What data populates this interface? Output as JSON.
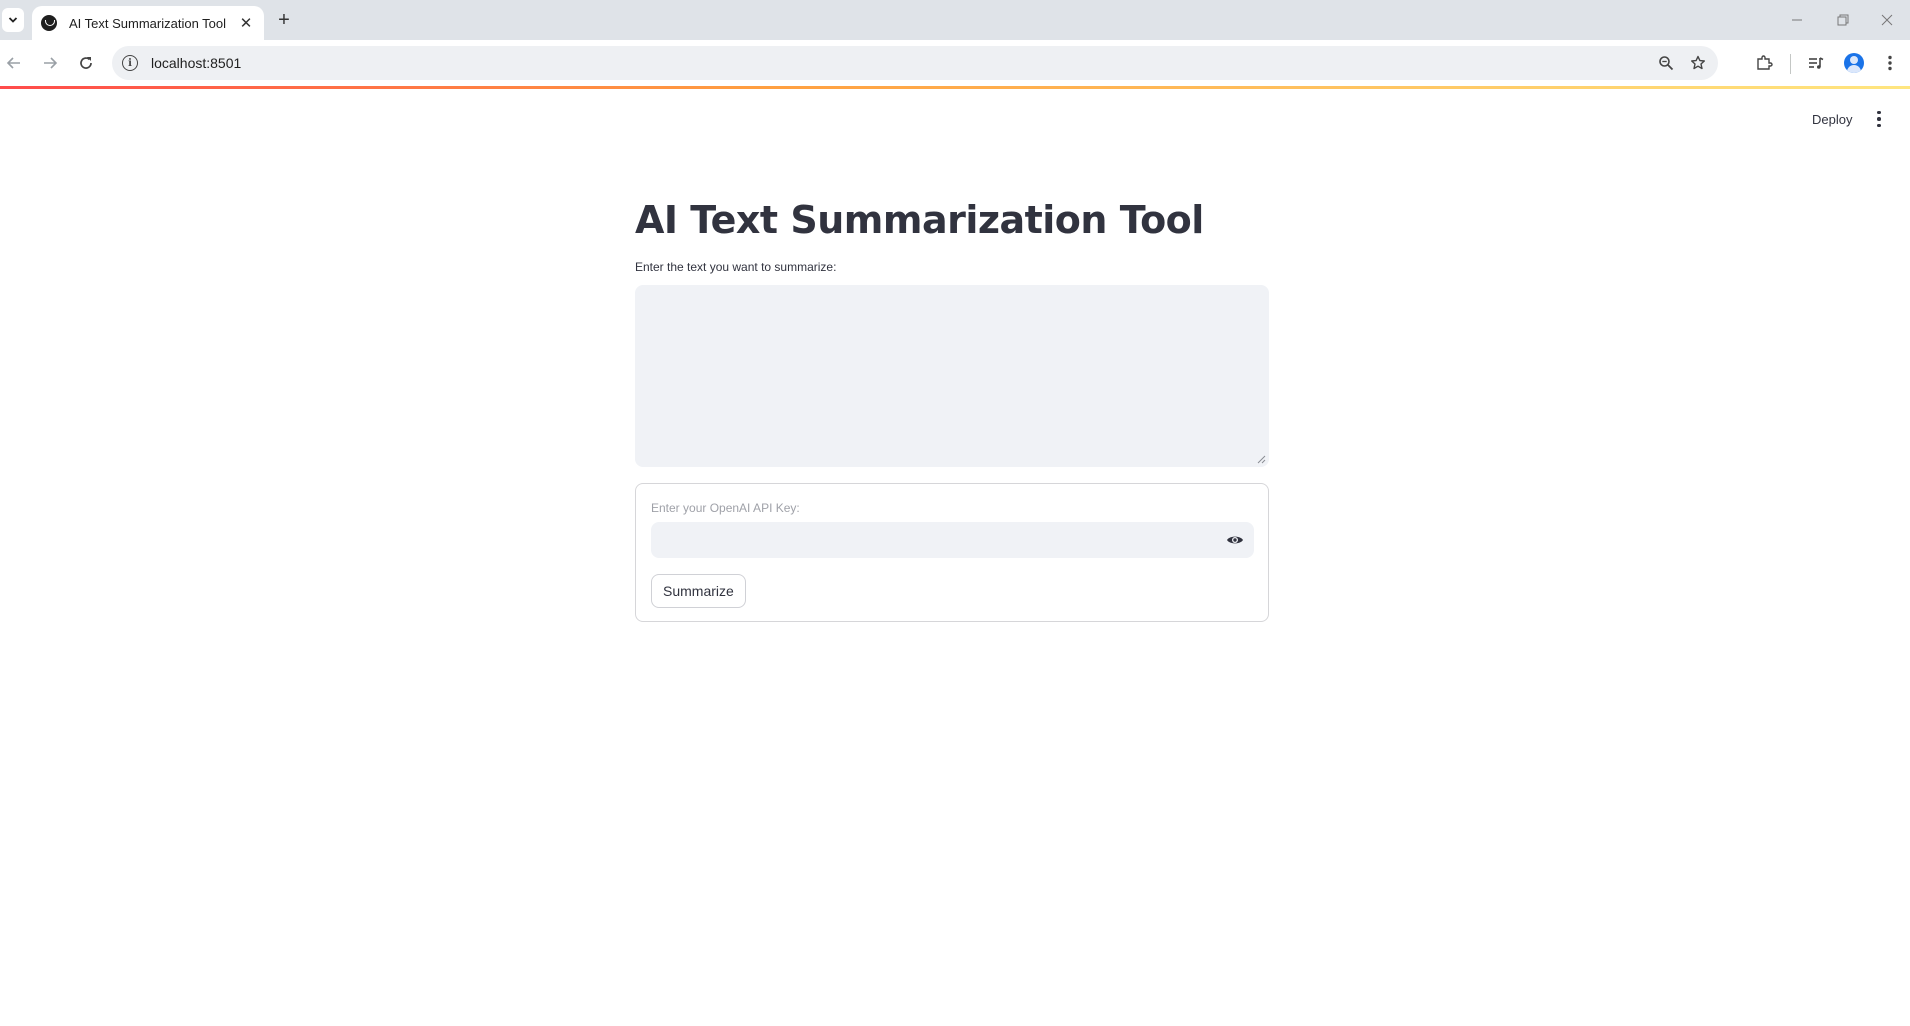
{
  "browser": {
    "tab_title": "AI Text Summarization Tool",
    "new_tab_label": "+",
    "url": "localhost:8501"
  },
  "app": {
    "deploy_label": "Deploy",
    "title": "AI Text Summarization Tool",
    "text_input_label": "Enter the text you want to summarize:",
    "text_input_value": "",
    "form": {
      "api_key_label": "Enter your OpenAI API Key:",
      "api_key_value": "",
      "submit_label": "Summarize"
    }
  },
  "colors": {
    "accent_gradient": [
      "#ff4b4b",
      "#ff9f40",
      "#ffe680"
    ],
    "input_background": "#f0f2f6",
    "text": "#31333f"
  }
}
